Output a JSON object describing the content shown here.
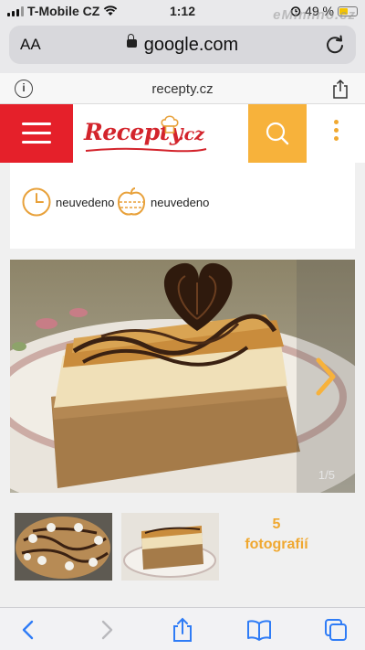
{
  "status_bar": {
    "carrier": "T-Mobile CZ",
    "time": "1:12",
    "battery": "49 %",
    "watermark": "eMimino.cz"
  },
  "browser": {
    "text_size_label": "AA",
    "url": "google.com",
    "site_domain": "recepty.cz"
  },
  "site": {
    "logo_text": "Recepty",
    "logo_suffix": ".cz",
    "prep_time": "neuvedeno",
    "difficulty": "neuvedeno"
  },
  "gallery": {
    "counter": "1/5",
    "photos_count": "5",
    "photos_label": "fotografií"
  },
  "colors": {
    "brand_red": "#e5202a",
    "accent_orange": "#f7b23b",
    "ios_blue": "#2f7cf6"
  },
  "icons": [
    "signal-icon",
    "wifi-icon",
    "alarm-icon",
    "battery-icon",
    "lock-icon",
    "reload-icon",
    "info-icon",
    "share-icon",
    "menu-icon",
    "search-icon",
    "more-icon",
    "clock-icon",
    "difficulty-icon",
    "chevron-right-icon",
    "back-icon",
    "forward-icon",
    "bookmarks-icon",
    "tabs-icon"
  ]
}
